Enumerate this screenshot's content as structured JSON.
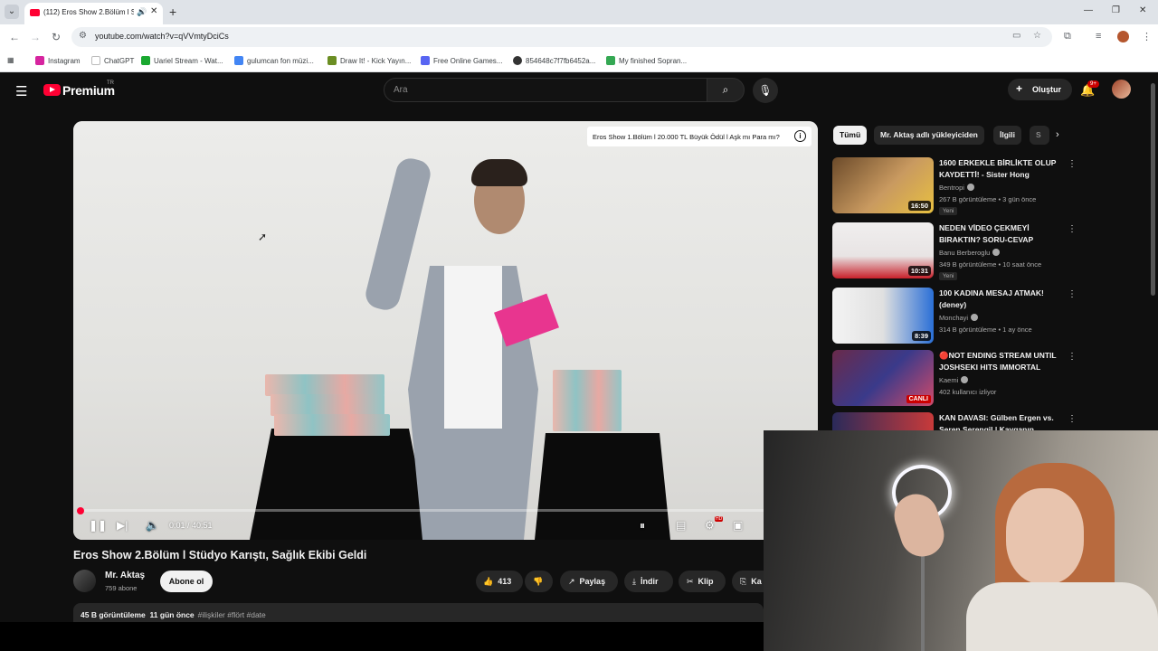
{
  "browser": {
    "tab_title": "(112) Eros Show 2.Bölüm l Stüdyo...",
    "url": "youtube.com/watch?v=qVVmtyDciCs",
    "bookmarks": [
      {
        "label": "Instagram",
        "color": "#d6249f"
      },
      {
        "label": "ChatGPT",
        "color": "#ffffff"
      },
      {
        "label": "Uariel Stream - Wat...",
        "color": "#1aa830"
      },
      {
        "label": "gulumcan fon müzi...",
        "color": "#4285f4"
      },
      {
        "label": "Draw It! - Kick Yayın...",
        "color": "#6b8e23"
      },
      {
        "label": "Free Online Games...",
        "color": "#5865f2"
      },
      {
        "label": "854648c7f7fb6452a...",
        "color": "#333333"
      },
      {
        "label": "My finished Sopran...",
        "color": "#34a853"
      }
    ]
  },
  "youtube": {
    "logo": "Premium",
    "country": "TR",
    "search_placeholder": "Ara",
    "create_label": "Oluştur",
    "notif_count": "9+",
    "overlay_title": "Eros Show 1.Bölüm l 20.000 TL Büyük Ödül l Aşk mı Para mı?",
    "progress_fraction": 0.0004,
    "time_current": "0:01",
    "time_total": "40:51",
    "time_display": "0:01 / 40:51",
    "video_title": "Eros Show 2.Bölüm l Stüdyo Karıştı, Sağlık Ekibi Geldi",
    "channel_name": "Mr. Aktaş",
    "subscribers": "759 abone",
    "subscribe_label": "Abone ol",
    "likes": "413",
    "share_label": "Paylaş",
    "download_label": "İndir",
    "clip_label": "Klip",
    "save_label": "Ka",
    "views": "45 B görüntüleme",
    "age": "11 gün önce",
    "tags": "#ilişkiler #flört #date",
    "chips": [
      "Tümü",
      "Mr. Aktaş adlı yükleyiciden",
      "İlgili",
      "S"
    ],
    "recommendations": [
      {
        "title": "1600 ERKEKLE BİRLİKTE OLUP KAYDETTİ! - Sister Hong",
        "channel": "Bentropi",
        "meta": "267 B görüntüleme • 3 gün önce",
        "badge": "Yeni",
        "duration": "16:50",
        "thumb_colors": [
          "#6b4a2a",
          "#e8c040"
        ]
      },
      {
        "title": "NEDEN VİDEO ÇEKMEYİ BIRAKTIN?  SORU-CEVAP",
        "channel": "Banu Berberoglu",
        "meta": "349 B görüntüleme • 10 saat önce",
        "badge": "Yeni",
        "duration": "10:31",
        "thumb_colors": [
          "#f0eeee",
          "#c8202a"
        ]
      },
      {
        "title": "100 KADINA MESAJ ATMAK! (deney)",
        "channel": "Monchayi",
        "meta": "314 B görüntüleme • 1 ay önce",
        "badge": "",
        "duration": "8:39",
        "thumb_colors": [
          "#f4f4f4",
          "#2a6fd6"
        ]
      },
      {
        "title": "🔴NOT ENDING STREAM UNTIL JOSHSEKI HITS IMMORTAL",
        "channel": "Kaemi",
        "meta": "402 kullanıcı izliyor",
        "badge": "",
        "duration": "CANLI",
        "thumb_colors": [
          "#6a2a4a",
          "#d14a6a"
        ]
      },
      {
        "title": "KAN DAVASI: Gülben Ergen vs. Seren Serengil | Kavganın",
        "channel": "",
        "meta": "",
        "badge": "",
        "duration": "",
        "thumb_colors": [
          "#2a2a5a",
          "#c83a3a"
        ]
      }
    ]
  }
}
